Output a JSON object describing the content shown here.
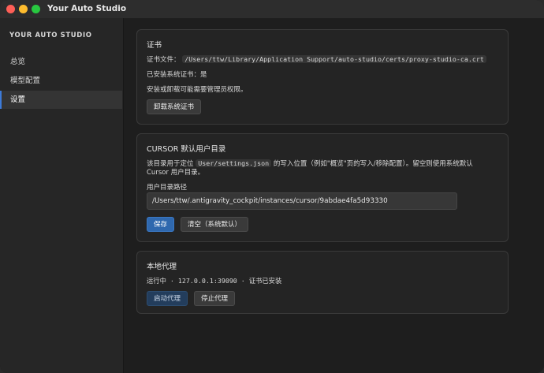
{
  "window": {
    "title": "Your Auto Studio"
  },
  "sidebar": {
    "brand": "YOUR AUTO STUDIO",
    "items": [
      {
        "label": "总览",
        "active": false
      },
      {
        "label": "模型配置",
        "active": false
      },
      {
        "label": "设置",
        "active": true
      }
    ]
  },
  "cert": {
    "title": "证书",
    "file_label": "证书文件：",
    "file_path": "/Users/ttw/Library/Application Support/auto-studio/certs/proxy-studio-ca.crt",
    "installed_text": "已安装系统证书：是",
    "hint": "安装或卸载可能需要管理员权限。",
    "uninstall_button": "卸载系统证书"
  },
  "cursor": {
    "title": "CURSOR 默认用户目录",
    "desc_prefix": "该目录用于定位",
    "desc_code": "User/settings.json",
    "desc_suffix": "的写入位置（例如\"概览\"页的写入/移除配置）。留空则使用系统默认",
    "desc_line2": "Cursor 用户目录。",
    "field_label": "用户目录路径",
    "field_value": "/Users/ttw/.antigravity_cockpit/instances/cursor/9abdae4fa5d93330",
    "save_button": "保存",
    "clear_button": "清空（系统默认）"
  },
  "proxy": {
    "title": "本地代理",
    "status": "运行中 · 127.0.0.1:39090 · 证书已安装",
    "start_button": "启动代理",
    "stop_button": "停止代理"
  },
  "colors": {
    "accent": "#2f68ae",
    "accent_dim": "#233d5c",
    "background": "#1e1e1e",
    "card": "#242424"
  }
}
